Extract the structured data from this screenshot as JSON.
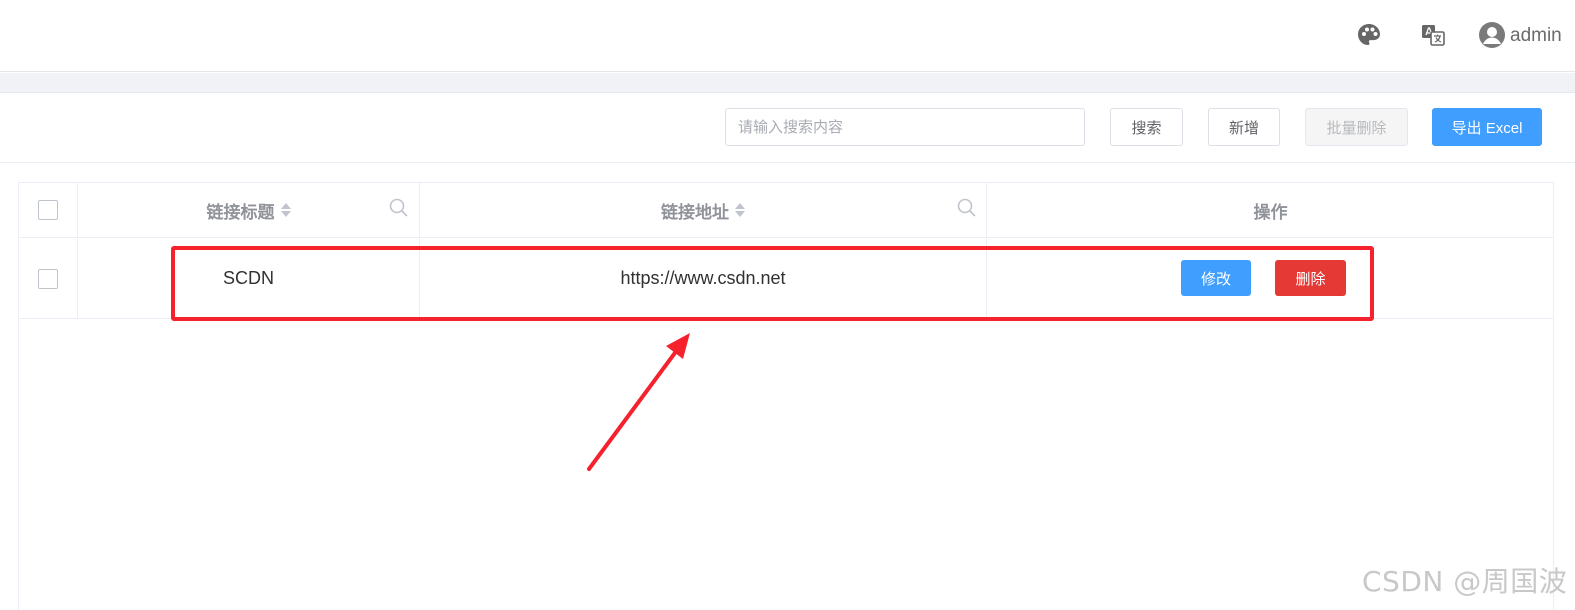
{
  "header": {
    "username": "admin",
    "icons": [
      "palette-icon",
      "translate-icon",
      "user-avatar-icon"
    ]
  },
  "toolbar": {
    "search_placeholder": "请输入搜索内容",
    "search_value": "",
    "search_label": "搜索",
    "add_label": "新增",
    "batch_delete_label": "批量删除",
    "export_label": "导出 Excel"
  },
  "table": {
    "columns": [
      "链接标题",
      "链接地址",
      "操作"
    ],
    "rows": [
      {
        "title": "SCDN",
        "url": "https://www.csdn.net",
        "edit_label": "修改",
        "delete_label": "删除"
      }
    ]
  },
  "colors": {
    "primary": "#409eff",
    "danger": "#e53935",
    "annotation": "#f5222d"
  },
  "watermark": "CSDN @周国波"
}
